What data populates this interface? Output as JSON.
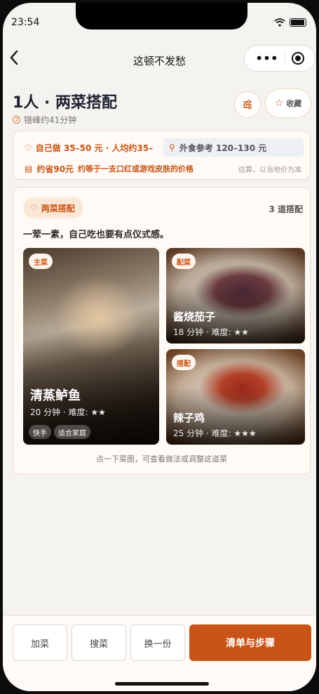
{
  "status_bar": {
    "time": "23:54"
  },
  "nav": {
    "title": "这顿不发愁",
    "back_icon": "chevron-left-icon",
    "more_icon": "more-dots-icon",
    "close_icon": "target-icon"
  },
  "header": {
    "title": "1人 · 两菜搭配",
    "subtitle": "错峰约41分钟",
    "favorite_label": "收藏"
  },
  "cost": {
    "self_cook": "自己做 35–50 元 · 人均约35–",
    "takeout_ref": "外食参考 120–130 元",
    "save_amount": "约省90元",
    "save_desc": "约等于一支口红或游戏皮肤的价格",
    "estimate_note": "估算，以当地价为准"
  },
  "combo": {
    "tag": "两菜搭配",
    "count": "3 道搭配",
    "slogan": "一荤一素，自己吃也要有点仪式感。",
    "hint": "点一下菜图，可查看做法或调整这道菜",
    "dishes": [
      {
        "tag": "主菜",
        "name": "清蒸鲈鱼",
        "meta": "20 分钟 · 难度: ★★",
        "badges": [
          "快手",
          "适合家庭"
        ]
      },
      {
        "tag": "配菜",
        "name": "酱烧茄子",
        "meta": "18 分钟 · 难度: ★★"
      },
      {
        "tag": "搭配",
        "name": "辣子鸡",
        "meta": "25 分钟 · 难度: ★★★"
      }
    ]
  },
  "actions": {
    "add": "加菜",
    "search": "搜菜",
    "swap": "换一份",
    "primary": "清单与步骤"
  },
  "colors": {
    "accent": "#c9541a",
    "background": "#f5f3ef",
    "card": "#fffaf5"
  }
}
